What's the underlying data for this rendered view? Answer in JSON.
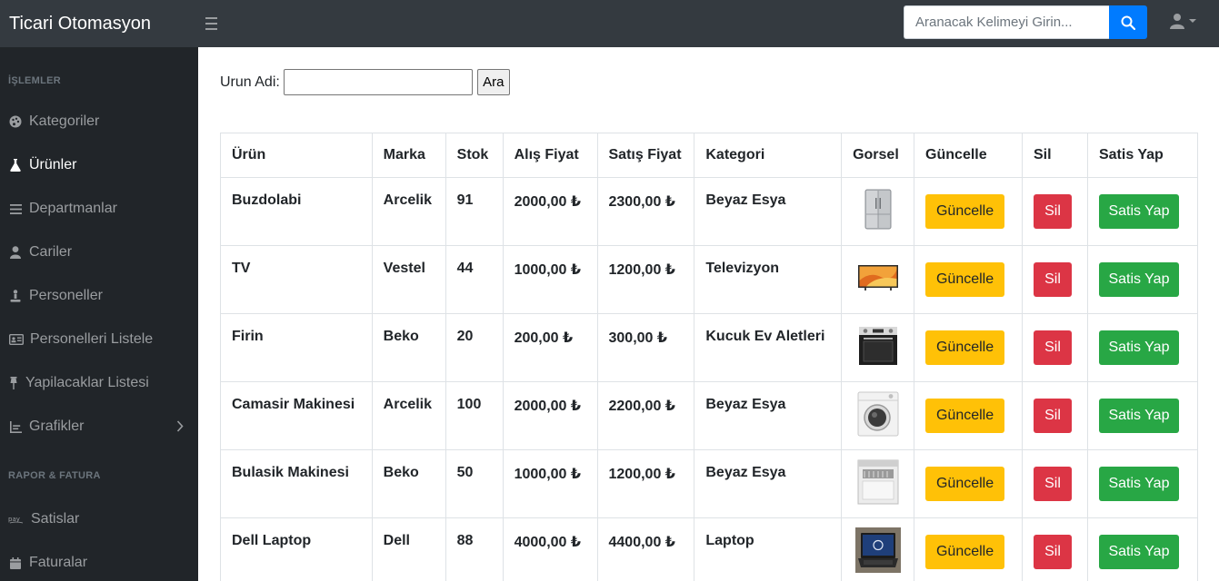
{
  "navbar": {
    "brand": "Ticari Otomasyon",
    "search_placeholder": "Aranacak Kelimeyi Girin..."
  },
  "sidebar": {
    "heading1": "İŞLEMLER",
    "items1": [
      {
        "label": "Kategoriler",
        "icon": "palette-icon"
      },
      {
        "label": "Ürünler",
        "icon": "flask-icon",
        "active": true
      },
      {
        "label": "Departmanlar",
        "icon": "list-icon"
      },
      {
        "label": "Cariler",
        "icon": "user-icon"
      },
      {
        "label": "Personeller",
        "icon": "person-icon"
      },
      {
        "label": "Personelleri Listele",
        "icon": "id-card-icon"
      },
      {
        "label": "Yapilacaklar Listesi",
        "icon": "pin-icon"
      },
      {
        "label": "Grafikler",
        "icon": "chart-icon"
      }
    ],
    "heading2": "RAPOR & FATURA",
    "items2": [
      {
        "label": "Satislar",
        "icon": "pay-icon"
      },
      {
        "label": "Faturalar",
        "icon": "calendar-icon"
      }
    ]
  },
  "filter": {
    "label": "Urun Adi:",
    "input_value": "",
    "button": "Ara"
  },
  "table": {
    "headers": [
      "Ürün",
      "Marka",
      "Stok",
      "Alış Fiyat",
      "Satış Fiyat",
      "Kategori",
      "Gorsel",
      "Güncelle",
      "Sil",
      "Satis Yap"
    ],
    "rows": [
      {
        "urun": "Buzdolabi",
        "marka": "Arcelik",
        "stok": "91",
        "alis": "2000,00 ₺",
        "satis": "2300,00 ₺",
        "kategori": "Beyaz Esya",
        "gorsel": "fridge-image"
      },
      {
        "urun": "TV",
        "marka": "Vestel",
        "stok": "44",
        "alis": "1000,00 ₺",
        "satis": "1200,00 ₺",
        "kategori": "Televizyon",
        "gorsel": "tv-image"
      },
      {
        "urun": "Firin",
        "marka": "Beko",
        "stok": "20",
        "alis": "200,00 ₺",
        "satis": "300,00 ₺",
        "kategori": "Kucuk Ev Aletleri",
        "gorsel": "oven-image"
      },
      {
        "urun": "Camasir Makinesi",
        "marka": "Arcelik",
        "stok": "100",
        "alis": "2000,00 ₺",
        "satis": "2200,00 ₺",
        "kategori": "Beyaz Esya",
        "gorsel": "washer-image"
      },
      {
        "urun": "Bulasik Makinesi",
        "marka": "Beko",
        "stok": "50",
        "alis": "1000,00 ₺",
        "satis": "1200,00 ₺",
        "kategori": "Beyaz Esya",
        "gorsel": "dishwasher-image"
      },
      {
        "urun": "Dell Laptop",
        "marka": "Dell",
        "stok": "88",
        "alis": "4000,00 ₺",
        "satis": "4400,00 ₺",
        "kategori": "Laptop",
        "gorsel": "laptop-image"
      }
    ],
    "btn_update": "Güncelle",
    "btn_delete": "Sil",
    "btn_sell": "Satis Yap"
  },
  "colors": {
    "navbar_bg": "#343a40",
    "sidebar_bg": "#212529",
    "primary": "#007bff",
    "warning": "#ffc107",
    "danger": "#dc3545",
    "success": "#28a745"
  }
}
